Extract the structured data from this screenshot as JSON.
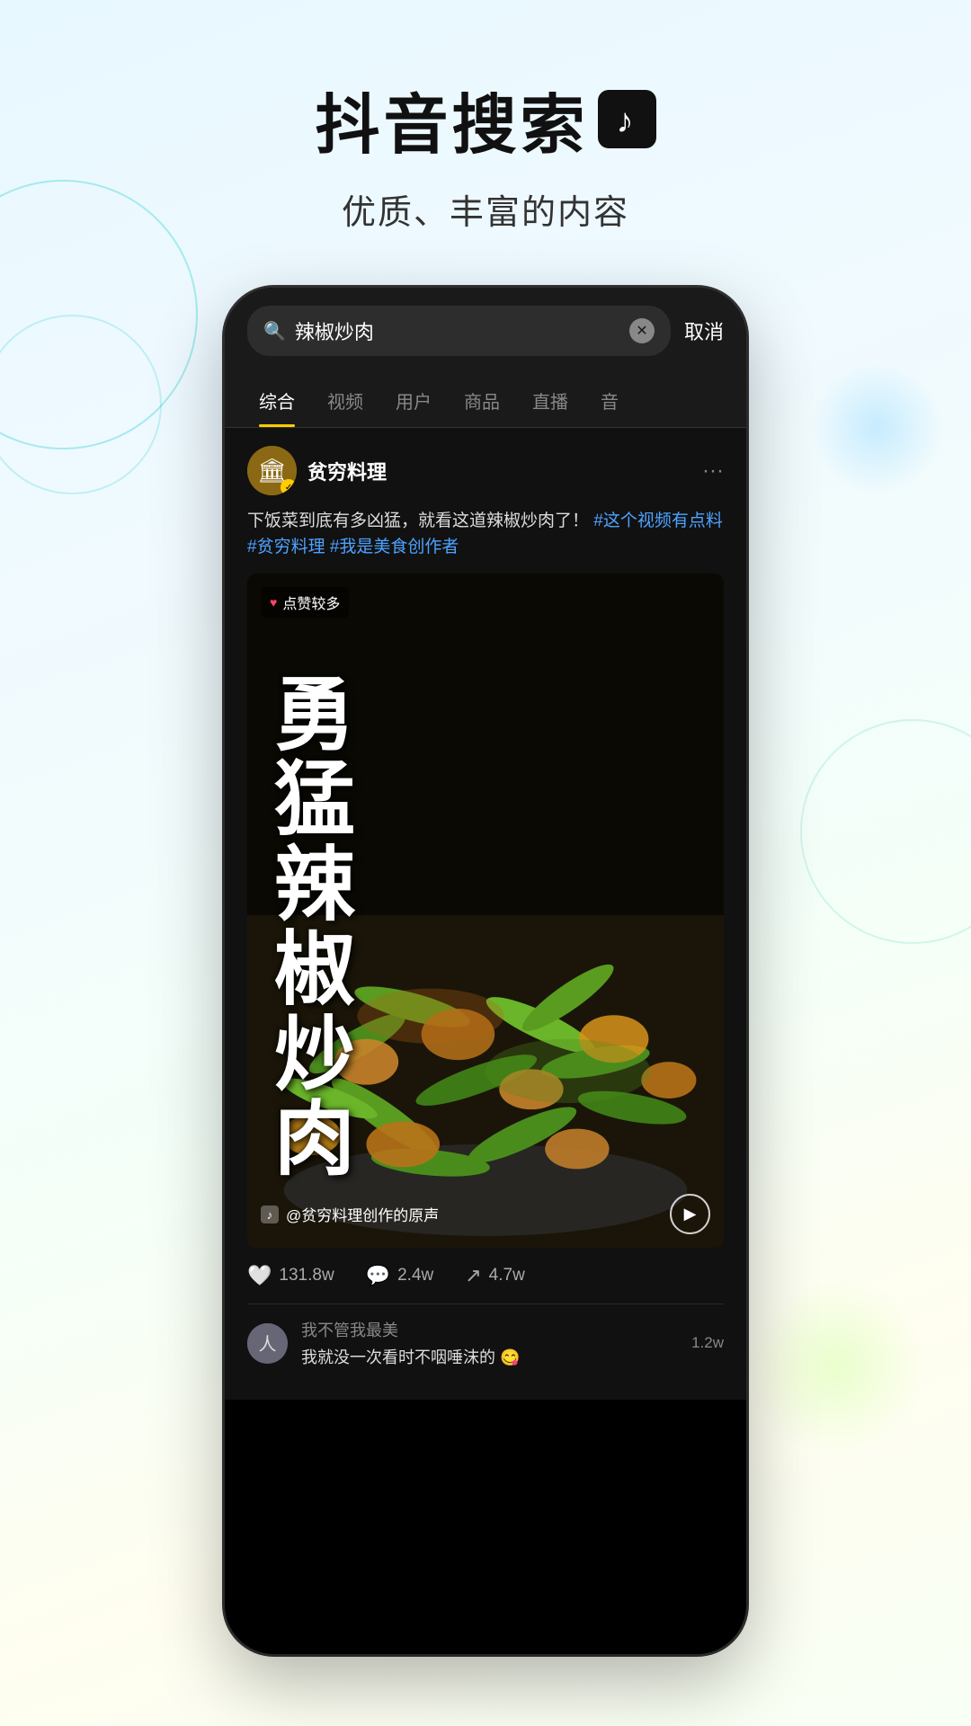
{
  "background": {
    "color": "#e8f8ff"
  },
  "header": {
    "title": "抖音搜索",
    "subtitle": "优质、丰富的内容",
    "tiktok_icon": "♪"
  },
  "search": {
    "query": "辣椒炒肉",
    "cancel_label": "取消"
  },
  "tabs": [
    {
      "label": "综合",
      "active": true
    },
    {
      "label": "视频",
      "active": false
    },
    {
      "label": "用户",
      "active": false
    },
    {
      "label": "商品",
      "active": false
    },
    {
      "label": "直播",
      "active": false
    },
    {
      "label": "音",
      "active": false
    }
  ],
  "post": {
    "username": "贫穷料理",
    "verified": true,
    "text_normal": "下饭菜到底有多凶猛，就看这道辣椒炒肉了！",
    "text_highlight": "#这个视频有点料 #贫穷料理 #我是美食创作者",
    "video_label": "点赞较多",
    "video_title": "勇\n猛\n辣\n椒\n炒\n肉",
    "video_source": "@贫穷料理创作的原声",
    "stats": {
      "likes": "131.8w",
      "comments": "2.4w",
      "shares": "4.7w"
    }
  },
  "comments": [
    {
      "name": "我不管我最美",
      "text": "我就没一次看时不咽唾沫的 😋",
      "likes": "1.2w"
    }
  ]
}
